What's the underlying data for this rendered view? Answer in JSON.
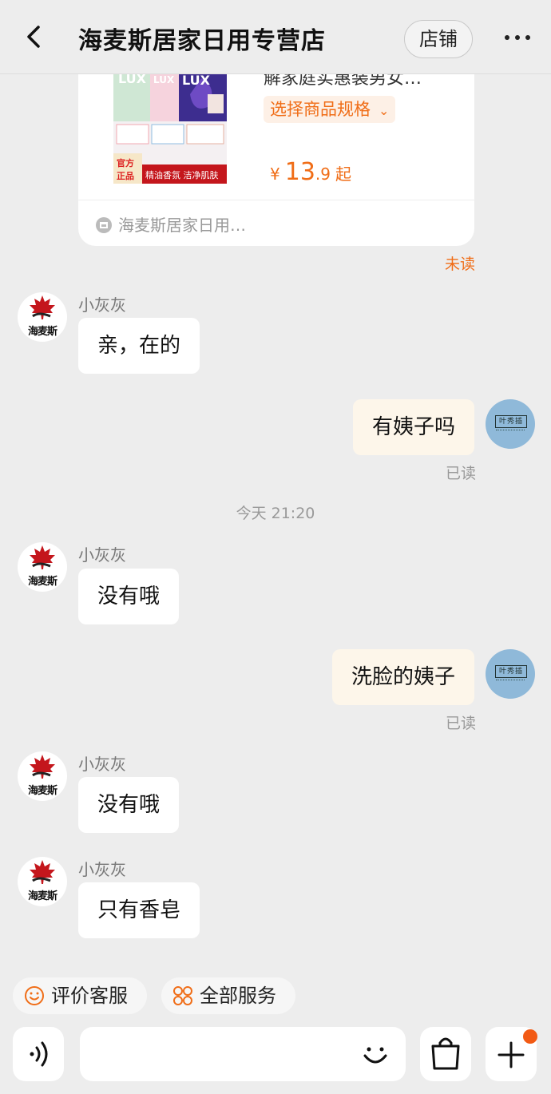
{
  "header": {
    "title": "海麦斯居家日用专营店",
    "shop_button": "店铺"
  },
  "product": {
    "description": "解家庭实惠装男女…",
    "spec_button": "选择商品规格",
    "price_symbol": "¥",
    "price_int": "13",
    "price_dec": ".9",
    "price_suffix": "起",
    "store_name": "海麦斯居家日用…",
    "image_banner_left": "官方正品",
    "image_banner_right": "精油香氛 洁净肌肤",
    "image_brand": "LUX",
    "unread_label": "未读"
  },
  "messages": [
    {
      "sender": "小灰灰",
      "text": "亲，在的"
    },
    {
      "text": "有姨子吗",
      "status": "已读"
    },
    {
      "sender": "小灰灰",
      "text": "没有哦"
    },
    {
      "text": "洗脸的姨子",
      "status": "已读"
    },
    {
      "sender": "小灰灰",
      "text": "没有哦"
    },
    {
      "sender": "小灰灰",
      "text": "只有香皂"
    }
  ],
  "timestamp": "今天 21:20",
  "shop_avatar_text": "海麦斯",
  "user_avatar_text": "叶秀插",
  "quick_actions": [
    {
      "label": "评价客服",
      "icon": "smile-face-icon"
    },
    {
      "label": "全部服务",
      "icon": "services-grid-icon"
    }
  ],
  "input": {
    "placeholder": ""
  },
  "colors": {
    "accent": "#f06d17",
    "badge": "#f25a14",
    "user_bubble": "#fdf6ea",
    "background": "#ededed"
  }
}
